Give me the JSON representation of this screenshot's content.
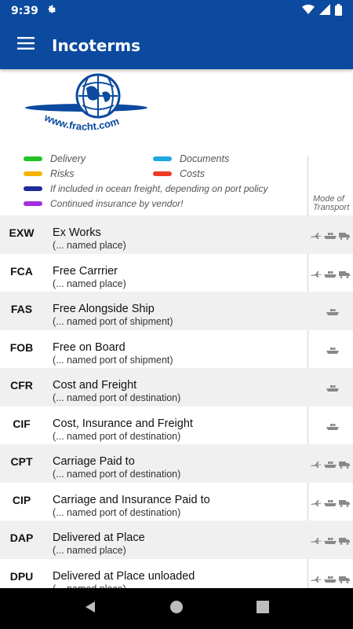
{
  "status": {
    "time": "9:39"
  },
  "appbar": {
    "title": "Incoterms"
  },
  "logo": {
    "text": "www.fracht.com"
  },
  "legend": {
    "delivery": "Delivery",
    "documents": "Documents",
    "risks": "Risks",
    "costs": "Costs",
    "ocean": "If included in ocean freight, depending on port policy",
    "insurance": "Continued insurance by vendor!",
    "colors": {
      "delivery": "#22c322",
      "documents": "#1fa8e0",
      "risks": "#f5b400",
      "costs": "#f03a2a",
      "ocean": "#1f2a9a",
      "insurance": "#a22ee0"
    }
  },
  "mode_label": {
    "line1": "Mode of",
    "line2": "Transport"
  },
  "terms": [
    {
      "code": "EXW",
      "name": "Ex Works",
      "sub": "(... named place)",
      "modes": "all"
    },
    {
      "code": "FCA",
      "name": "Free Carrrier",
      "sub": "(... named place)",
      "modes": "all"
    },
    {
      "code": "FAS",
      "name": "Free Alongside Ship",
      "sub": "(... named port of shipment)",
      "modes": "sea"
    },
    {
      "code": "FOB",
      "name": "Free on Board",
      "sub": "(... named port of shipment)",
      "modes": "sea"
    },
    {
      "code": "CFR",
      "name": "Cost and Freight",
      "sub": "(... named port of destination)",
      "modes": "sea"
    },
    {
      "code": "CIF",
      "name": "Cost, Insurance and Freight",
      "sub": "(... named port of destination)",
      "modes": "sea"
    },
    {
      "code": "CPT",
      "name": "Carriage Paid to",
      "sub": "(... named port of destination)",
      "modes": "all"
    },
    {
      "code": "CIP",
      "name": "Carriage and Insurance Paid to",
      "sub": "(... named port of destination)",
      "modes": "all"
    },
    {
      "code": "DAP",
      "name": "Delivered at Place",
      "sub": "(... named place)",
      "modes": "all"
    },
    {
      "code": "DPU",
      "name": "Delivered at Place unloaded",
      "sub": "(... named place)",
      "modes": "all"
    }
  ]
}
